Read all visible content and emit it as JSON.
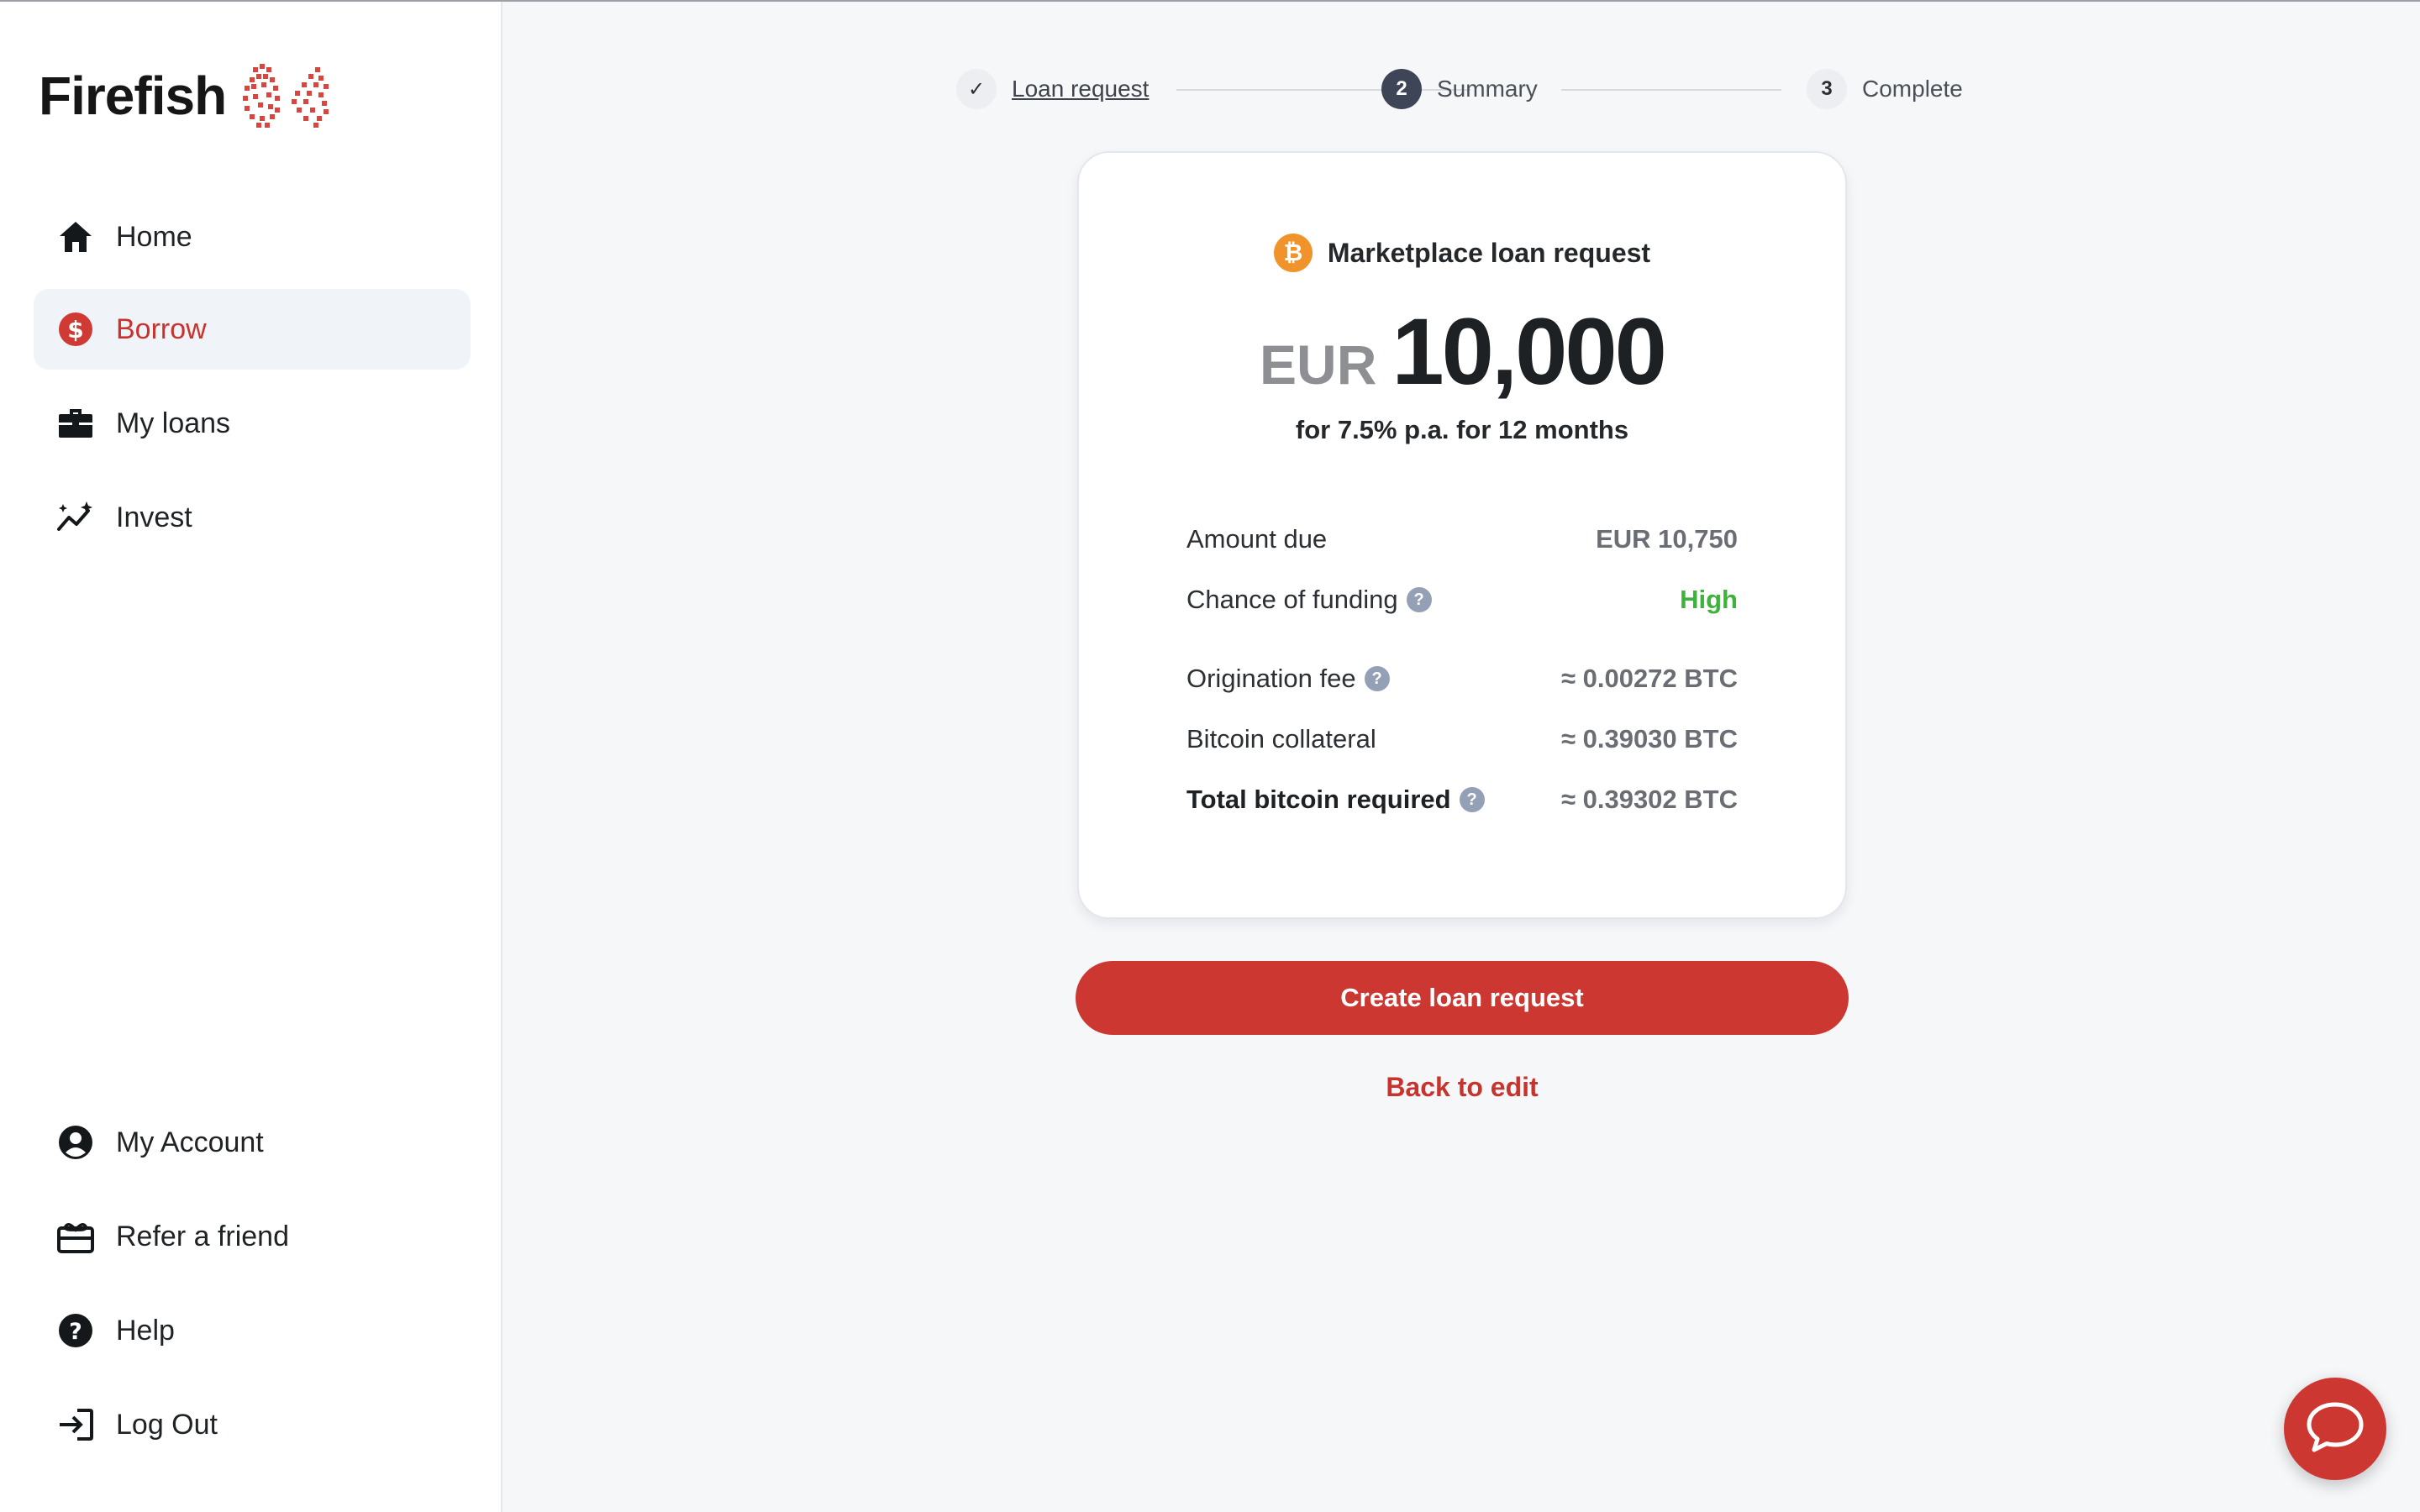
{
  "app": {
    "name": "Firefish"
  },
  "sidebar": {
    "items": [
      {
        "label": "Home",
        "icon": "home-icon"
      },
      {
        "label": "Borrow",
        "icon": "dollar-circle-icon",
        "active": true
      },
      {
        "label": "My loans",
        "icon": "briefcase-icon"
      },
      {
        "label": "Invest",
        "icon": "sparkle-chart-icon"
      }
    ],
    "bottom_items": [
      {
        "label": "My Account",
        "icon": "account-circle-icon"
      },
      {
        "label": "Refer a friend",
        "icon": "gift-card-icon"
      },
      {
        "label": "Help",
        "icon": "help-circle-icon"
      },
      {
        "label": "Log Out",
        "icon": "logout-icon"
      }
    ]
  },
  "stepper": {
    "steps": [
      {
        "label": "Loan request",
        "marker": "✓",
        "state": "done"
      },
      {
        "label": "Summary",
        "marker": "2",
        "state": "current"
      },
      {
        "label": "Complete",
        "marker": "3",
        "state": "upcoming"
      }
    ]
  },
  "summary": {
    "title": "Marketplace loan request",
    "currency": "EUR",
    "amount": "10,000",
    "terms": "for 7.5% p.a. for 12 months",
    "rows": [
      {
        "label": "Amount due",
        "value": "EUR 10,750"
      },
      {
        "label": "Chance of funding",
        "value": "High"
      },
      {
        "label": "Origination fee",
        "value": "≈ 0.00272 BTC"
      },
      {
        "label": "Bitcoin collateral",
        "value": "≈ 0.39030 BTC"
      },
      {
        "label": "Total bitcoin required",
        "value": "≈ 0.39302 BTC"
      }
    ],
    "help_glyph": "?"
  },
  "actions": {
    "create_label": "Create loan request",
    "back_label": "Back to edit"
  },
  "colors": {
    "accent": "#cd3731",
    "bitcoin": "#f0932b",
    "success": "#3db33b",
    "step_current": "#3d4556"
  }
}
